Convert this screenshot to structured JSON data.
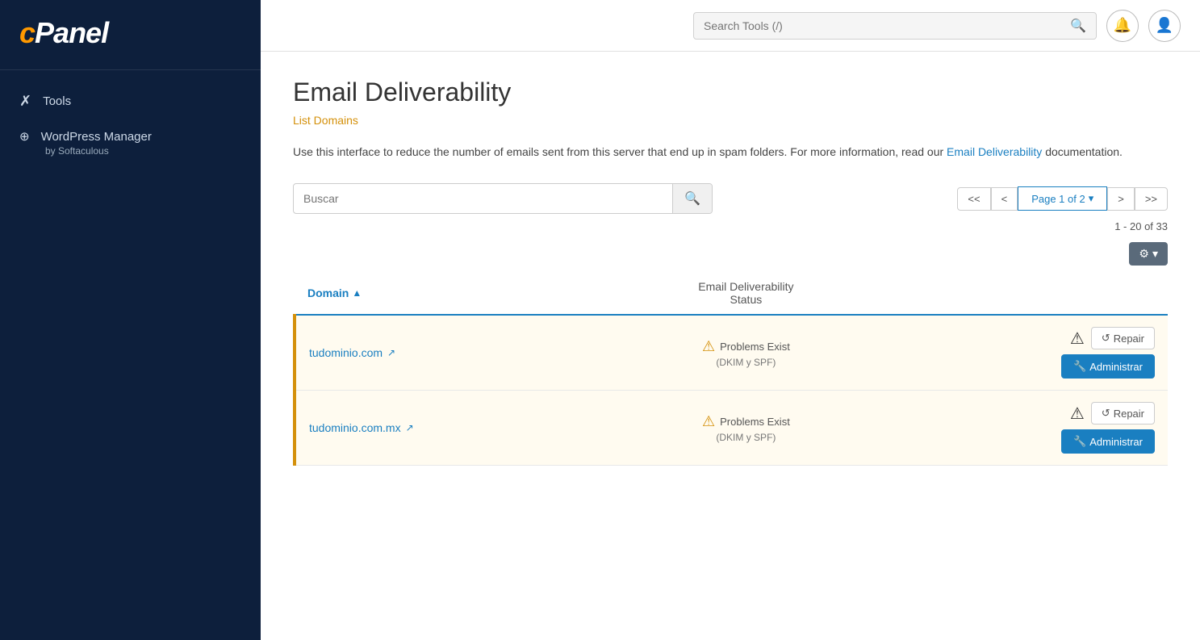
{
  "sidebar": {
    "logo": "cPanel",
    "nav_items": [
      {
        "id": "tools",
        "icon": "✗",
        "label": "Tools"
      },
      {
        "id": "wordpress",
        "icon": "⊕",
        "label": "WordPress Manager",
        "sub": "by Softaculous"
      }
    ]
  },
  "header": {
    "search_placeholder": "Search Tools (/)",
    "search_label": "Search Tools (/)"
  },
  "page": {
    "title": "Email Deliverability",
    "breadcrumb": "List Domains",
    "description_before": "Use this interface to reduce the number of emails sent from this server that end up in spam folders. For more information, read our ",
    "description_link": "Email Deliverability",
    "description_after": " documentation.",
    "search_placeholder": "Buscar",
    "pagination": {
      "first": "<<",
      "prev": "<",
      "current": "Page 1 of 2",
      "next": ">",
      "last": ">>"
    },
    "count_text": "1 - 20 of 33",
    "table": {
      "col_domain": "Domain",
      "col_status": "Email Deliverability\nStatus",
      "rows": [
        {
          "domain": "tudominio.com",
          "status_text": "Problems Exist",
          "status_sub": "(DKIM y SPF)",
          "repair_label": "Repair",
          "admin_label": "Administrar"
        },
        {
          "domain": "tudominio.com.mx",
          "status_text": "Problems Exist",
          "status_sub": "(DKIM y SPF)",
          "repair_label": "Repair",
          "admin_label": "Administrar"
        }
      ]
    }
  }
}
